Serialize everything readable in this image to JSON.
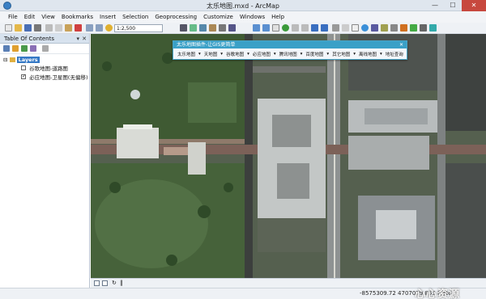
{
  "window": {
    "title": "太乐地图.mxd - ArcMap"
  },
  "menu": [
    "File",
    "Edit",
    "View",
    "Bookmarks",
    "Insert",
    "Selection",
    "Geoprocessing",
    "Customize",
    "Windows",
    "Help"
  ],
  "toolbar": {
    "scale": "1:2,500"
  },
  "toc": {
    "title": "Table Of Contents",
    "layers_label": "Layers",
    "items": [
      {
        "label": "谷歌地图-道路图",
        "checked": false
      },
      {
        "label": "必应地图-卫星图(无偏移)",
        "checked": true
      }
    ]
  },
  "plugin": {
    "title": "太乐地图插件-让GIS更简单",
    "menus": [
      "太乐地图",
      "天地图",
      "谷歌地图",
      "必应地图",
      "腾讯地图",
      "百度地图",
      "其它地图",
      "离线地图",
      "地址查询"
    ]
  },
  "status": {
    "coords": "-8575309.72  4707079.853 Meters"
  },
  "watermark": "心心资源",
  "colors": {
    "accent": "#3aa0c7",
    "layer_highlight": "#3478c5",
    "close": "#c7483e"
  }
}
